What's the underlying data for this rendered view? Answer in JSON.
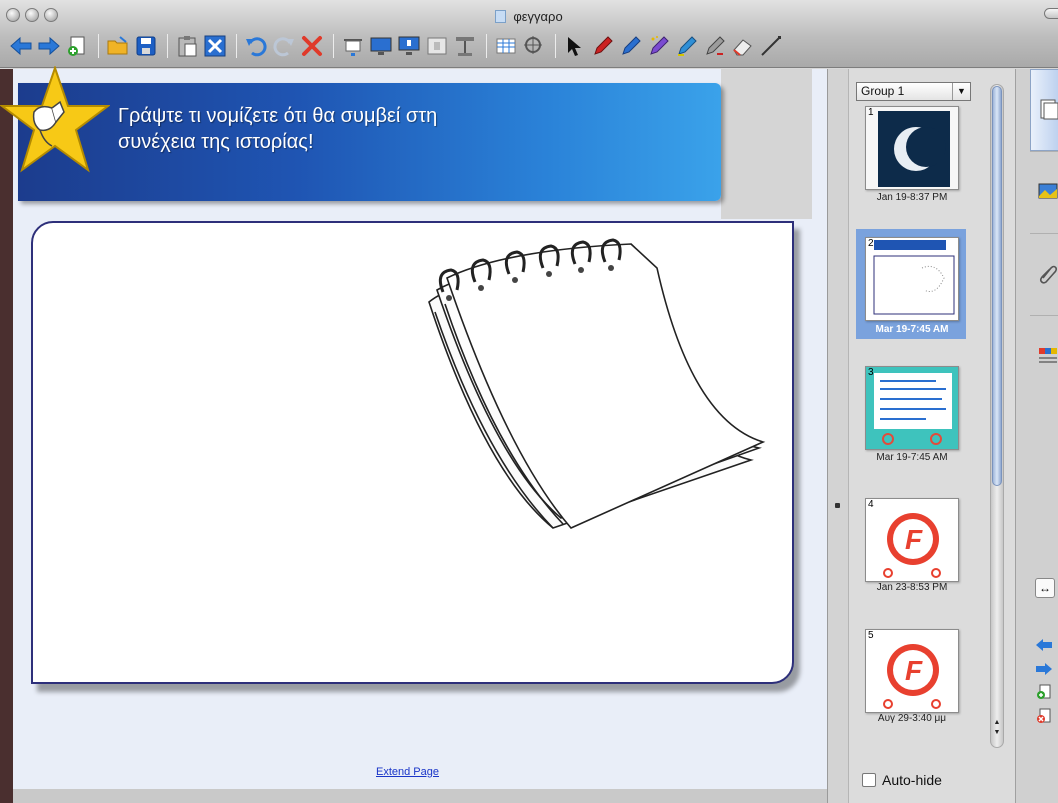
{
  "window": {
    "title": "φεγγαρο"
  },
  "toolbar": {
    "icons": [
      "previous-page-icon",
      "next-page-icon",
      "add-page-icon",
      "open-icon",
      "save-icon",
      "paste-icon",
      "screen-shade-icon",
      "undo-icon",
      "redo-icon",
      "delete-icon",
      "show-toolbar-icon",
      "screen-icon",
      "projector-icon",
      "capture-icon",
      "table-icon",
      "table-tool-icon",
      "measure-icon",
      "select-icon",
      "pen-icon",
      "creative-pen-icon",
      "magic-pen-icon",
      "highlighter-icon",
      "eraser-icon",
      "line-icon"
    ]
  },
  "lesson": {
    "heading": "Γράψτε τι νομίζετε ότι θα συμβεί στη συνέχεια της ιστορίας!",
    "extend_link": "Extend Page"
  },
  "sorter": {
    "group": "Group 1",
    "slides": [
      {
        "num": "1",
        "date": "Jan 19-8:37 PM",
        "selected": false
      },
      {
        "num": "2",
        "date": "Mar 19-7:45 AM",
        "selected": true
      },
      {
        "num": "3",
        "date": "Mar 19-7:45 AM",
        "selected": false
      },
      {
        "num": "4",
        "date": "Jan 23-8:53 PM",
        "selected": false
      },
      {
        "num": "5",
        "date": "Αυγ 29-3:40 μμ",
        "selected": false
      }
    ],
    "autohide_label": "Auto-hide"
  },
  "colors": {
    "banner_dark": "#1c3c8d",
    "banner_light": "#3aa2ea",
    "card_border": "#2d2f7a",
    "link": "#1a35c8",
    "selected_slide": "#7aa2dd"
  }
}
